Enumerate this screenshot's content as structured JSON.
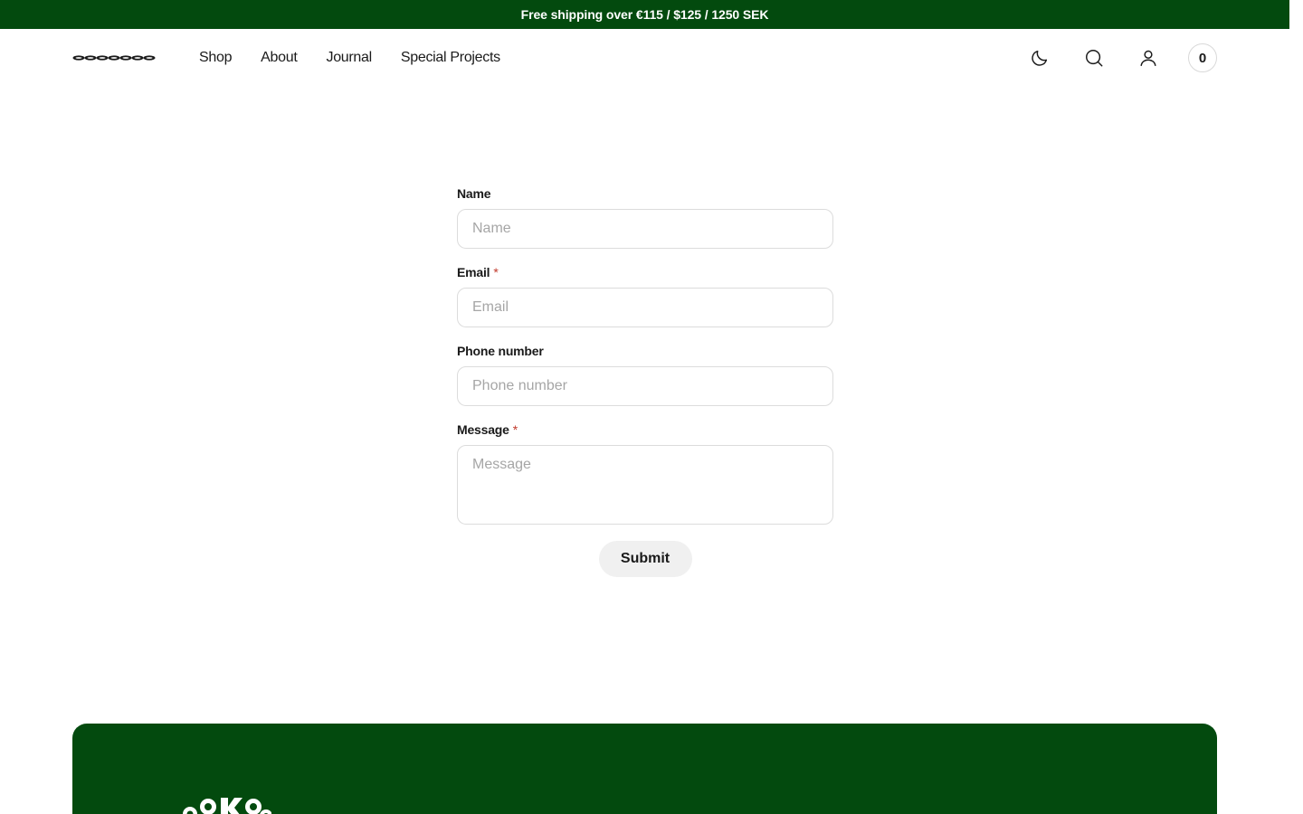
{
  "announcement": {
    "text": "Free shipping over €115 / $125 / 1250 SEK"
  },
  "brand": {
    "name": "SOCKSSS",
    "accent": "#034a0e"
  },
  "nav": {
    "items": [
      {
        "label": "Shop"
      },
      {
        "label": "About"
      },
      {
        "label": "Journal"
      },
      {
        "label": "Special Projects"
      }
    ]
  },
  "header_icons": {
    "theme": "moon-icon",
    "search": "search-icon",
    "account": "user-icon",
    "cart_count": "0"
  },
  "form": {
    "name": {
      "label": "Name",
      "placeholder": "Name",
      "required": false
    },
    "email": {
      "label": "Email",
      "placeholder": "Email",
      "required": true
    },
    "phone": {
      "label": "Phone number",
      "placeholder": "Phone number",
      "required": false
    },
    "message": {
      "label": "Message",
      "placeholder": "Message",
      "required": true
    },
    "required_marker": "*",
    "submit_label": "Submit"
  }
}
